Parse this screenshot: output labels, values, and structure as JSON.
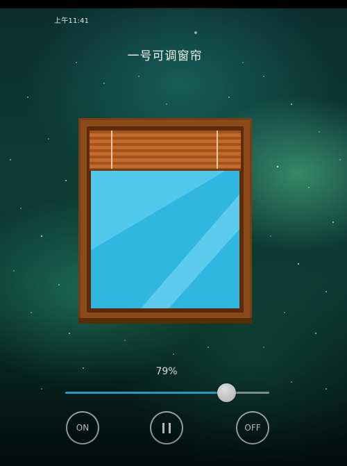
{
  "status_bar": {
    "time": "上午11:41"
  },
  "header": {
    "title": "一号可调窗帘"
  },
  "blind": {
    "open_percent": 79
  },
  "slider": {
    "label": "79%",
    "value_fraction": 0.79,
    "accent_color": "#27b2e0"
  },
  "controls": {
    "on_label": "ON",
    "pause_icon": "pause-icon",
    "off_label": "OFF"
  }
}
